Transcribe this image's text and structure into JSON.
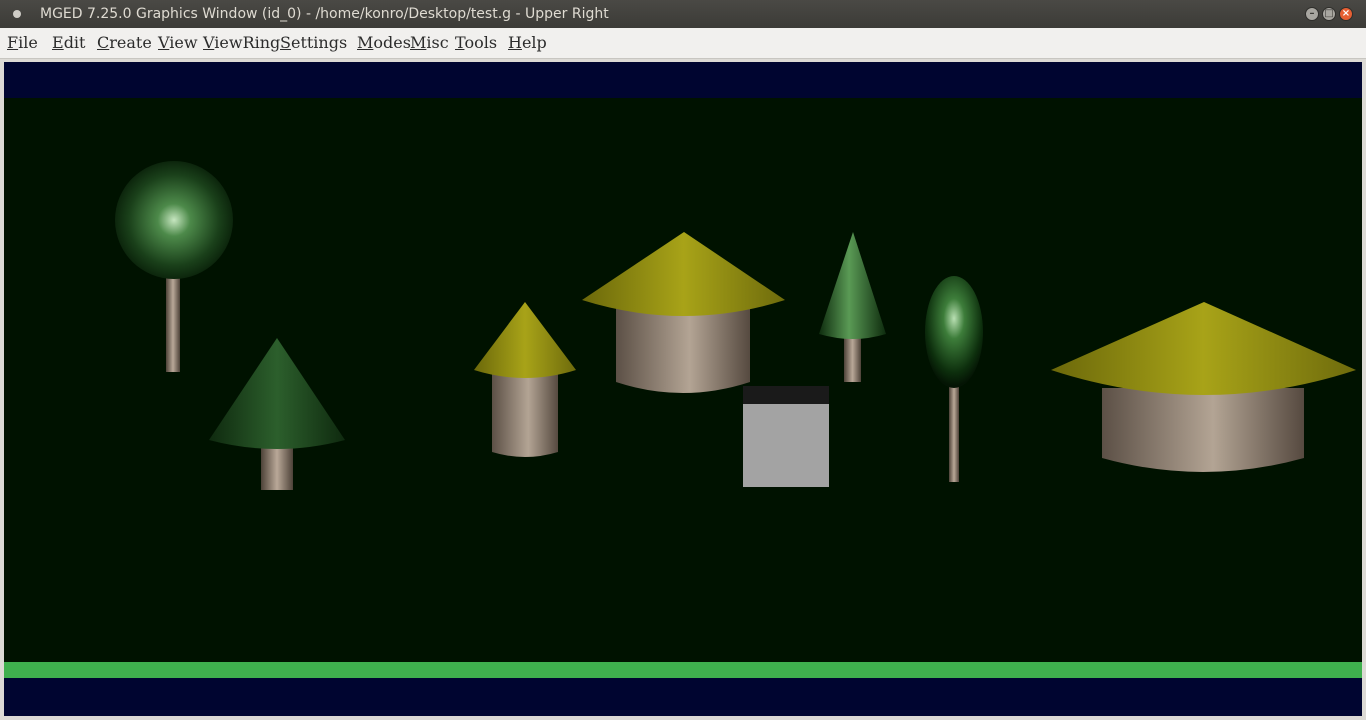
{
  "window": {
    "title": "MGED 7.25.0 Graphics Window (id_0) - /home/konro/Desktop/test.g - Upper Right",
    "buttons": {
      "minimize_icon": "minimize-icon",
      "maximize_icon": "maximize-icon",
      "close_icon": "close-icon"
    }
  },
  "menubar": {
    "items": [
      {
        "label": "File"
      },
      {
        "label": "Edit"
      },
      {
        "label": "Create"
      },
      {
        "label": "View"
      },
      {
        "label": "ViewRing"
      },
      {
        "label": "Settings"
      },
      {
        "label": "Modes"
      },
      {
        "label": "Misc"
      },
      {
        "label": "Tools"
      },
      {
        "label": "Help"
      }
    ]
  },
  "viewport": {
    "background_color": "#001200",
    "band_color": "#000530",
    "status_bar_color": "#3fb04e",
    "objects": [
      {
        "kind": "tree-round",
        "foliage_color": "#2f6b2f",
        "trunk_color": "#a08e7e"
      },
      {
        "kind": "tree-cone",
        "foliage_color": "#1f4a1f",
        "trunk_color": "#a08e7e"
      },
      {
        "kind": "hut-small",
        "roof_color": "#9e9a13",
        "wall_color": "#a39484"
      },
      {
        "kind": "hut-medium",
        "roof_color": "#9e9a13",
        "wall_color": "#a39484"
      },
      {
        "kind": "tree-slim-cone",
        "foliage_color": "#2a6a2a",
        "trunk_color": "#a08e7e"
      },
      {
        "kind": "tree-ellipse",
        "foliage_color": "#2a6a2a",
        "trunk_color": "#a08e7e"
      },
      {
        "kind": "hut-large",
        "roof_color": "#9e9a13",
        "wall_color": "#a39484"
      },
      {
        "kind": "box",
        "face_color": "#a3a3a3",
        "top_color": "#1a1a1a"
      }
    ]
  }
}
